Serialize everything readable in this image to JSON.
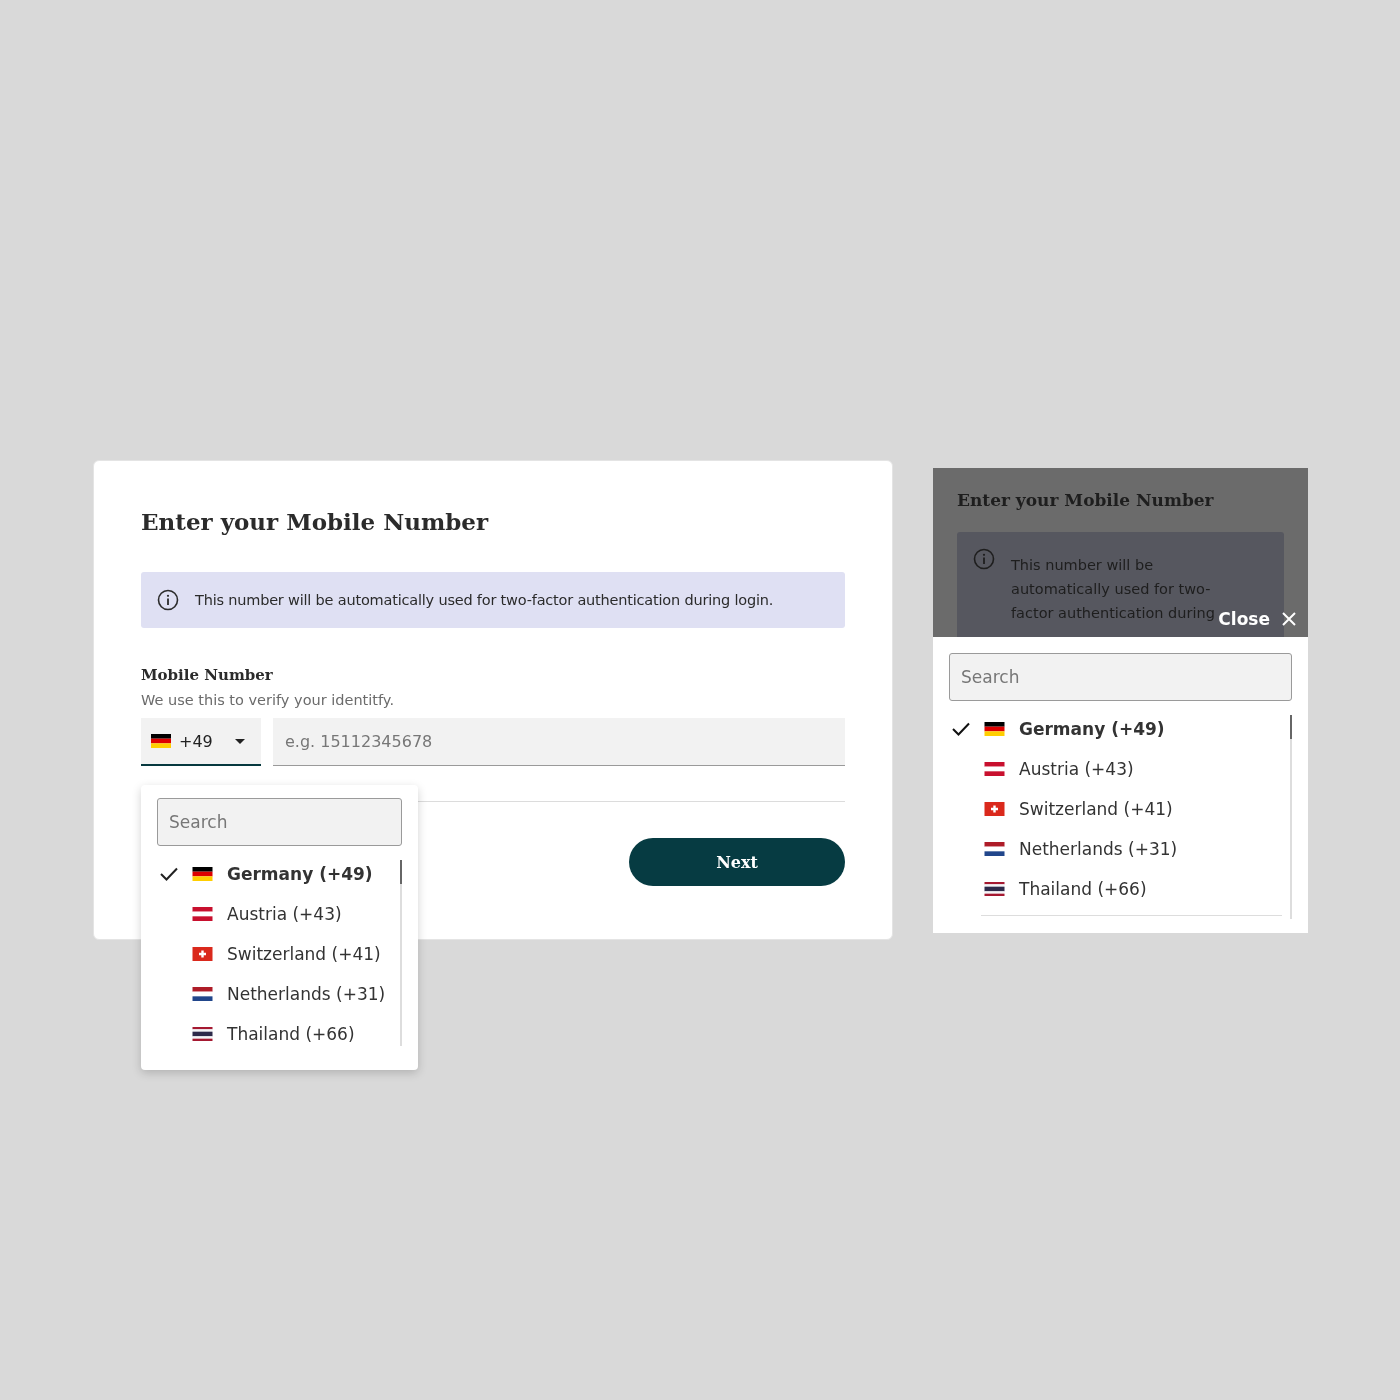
{
  "desktop": {
    "title": "Enter your Mobile Number",
    "info": "This number will be automatically used for two-factor authentication during login.",
    "field_label": "Mobile Number",
    "field_hint": "We use this to verify your identitfy.",
    "country_code": "+49",
    "phone_placeholder": "e.g. 15112345678",
    "next_button": "Next",
    "dropdown": {
      "search_placeholder": "Search",
      "countries": [
        {
          "label": "Germany (+49)",
          "selected": true
        },
        {
          "label": "Austria (+43)",
          "selected": false
        },
        {
          "label": "Switzerland (+41)",
          "selected": false
        },
        {
          "label": "Netherlands (+31)",
          "selected": false
        },
        {
          "label": "Thailand (+66)",
          "selected": false
        }
      ]
    }
  },
  "mobile": {
    "title": "Enter your Mobile Number",
    "info": "This number will be automatically used for two-factor authentication during",
    "close_button": "Close",
    "dropdown": {
      "search_placeholder": "Search",
      "countries": [
        {
          "label": "Germany (+49)",
          "selected": true
        },
        {
          "label": "Austria (+43)",
          "selected": false
        },
        {
          "label": "Switzerland (+41)",
          "selected": false
        },
        {
          "label": "Netherlands (+31)",
          "selected": false
        },
        {
          "label": "Thailand (+66)",
          "selected": false
        }
      ]
    }
  }
}
